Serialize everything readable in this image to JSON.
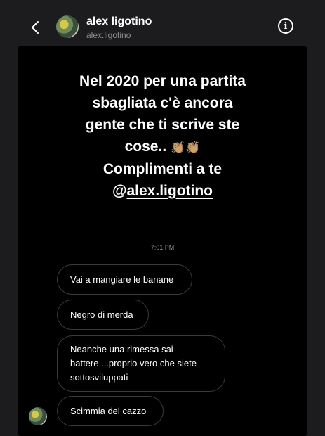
{
  "header": {
    "name": "alex ligotino",
    "handle": "alex.ligotino",
    "back_icon": "chevron-left-icon",
    "info_icon": "info-icon",
    "info_glyph": "i"
  },
  "story": {
    "lines": [
      "Nel 2020 per una partita",
      "sbagliata c'è ancora",
      "gente che ti scrive ste",
      "cose..",
      "Complimenti a te"
    ],
    "emoji": "👏🏽👏🏽",
    "mention": "@alex.ligotino"
  },
  "timestamp": "7:01 PM",
  "messages": [
    {
      "text": "Vai a mangiare le banane"
    },
    {
      "text": "Negro di merda"
    },
    {
      "lines": [
        "Neanche una rimessa sai",
        "battere ...proprio vero che siete",
        "sottosviluppati"
      ]
    },
    {
      "text": "Scimmia del cazzo"
    }
  ]
}
